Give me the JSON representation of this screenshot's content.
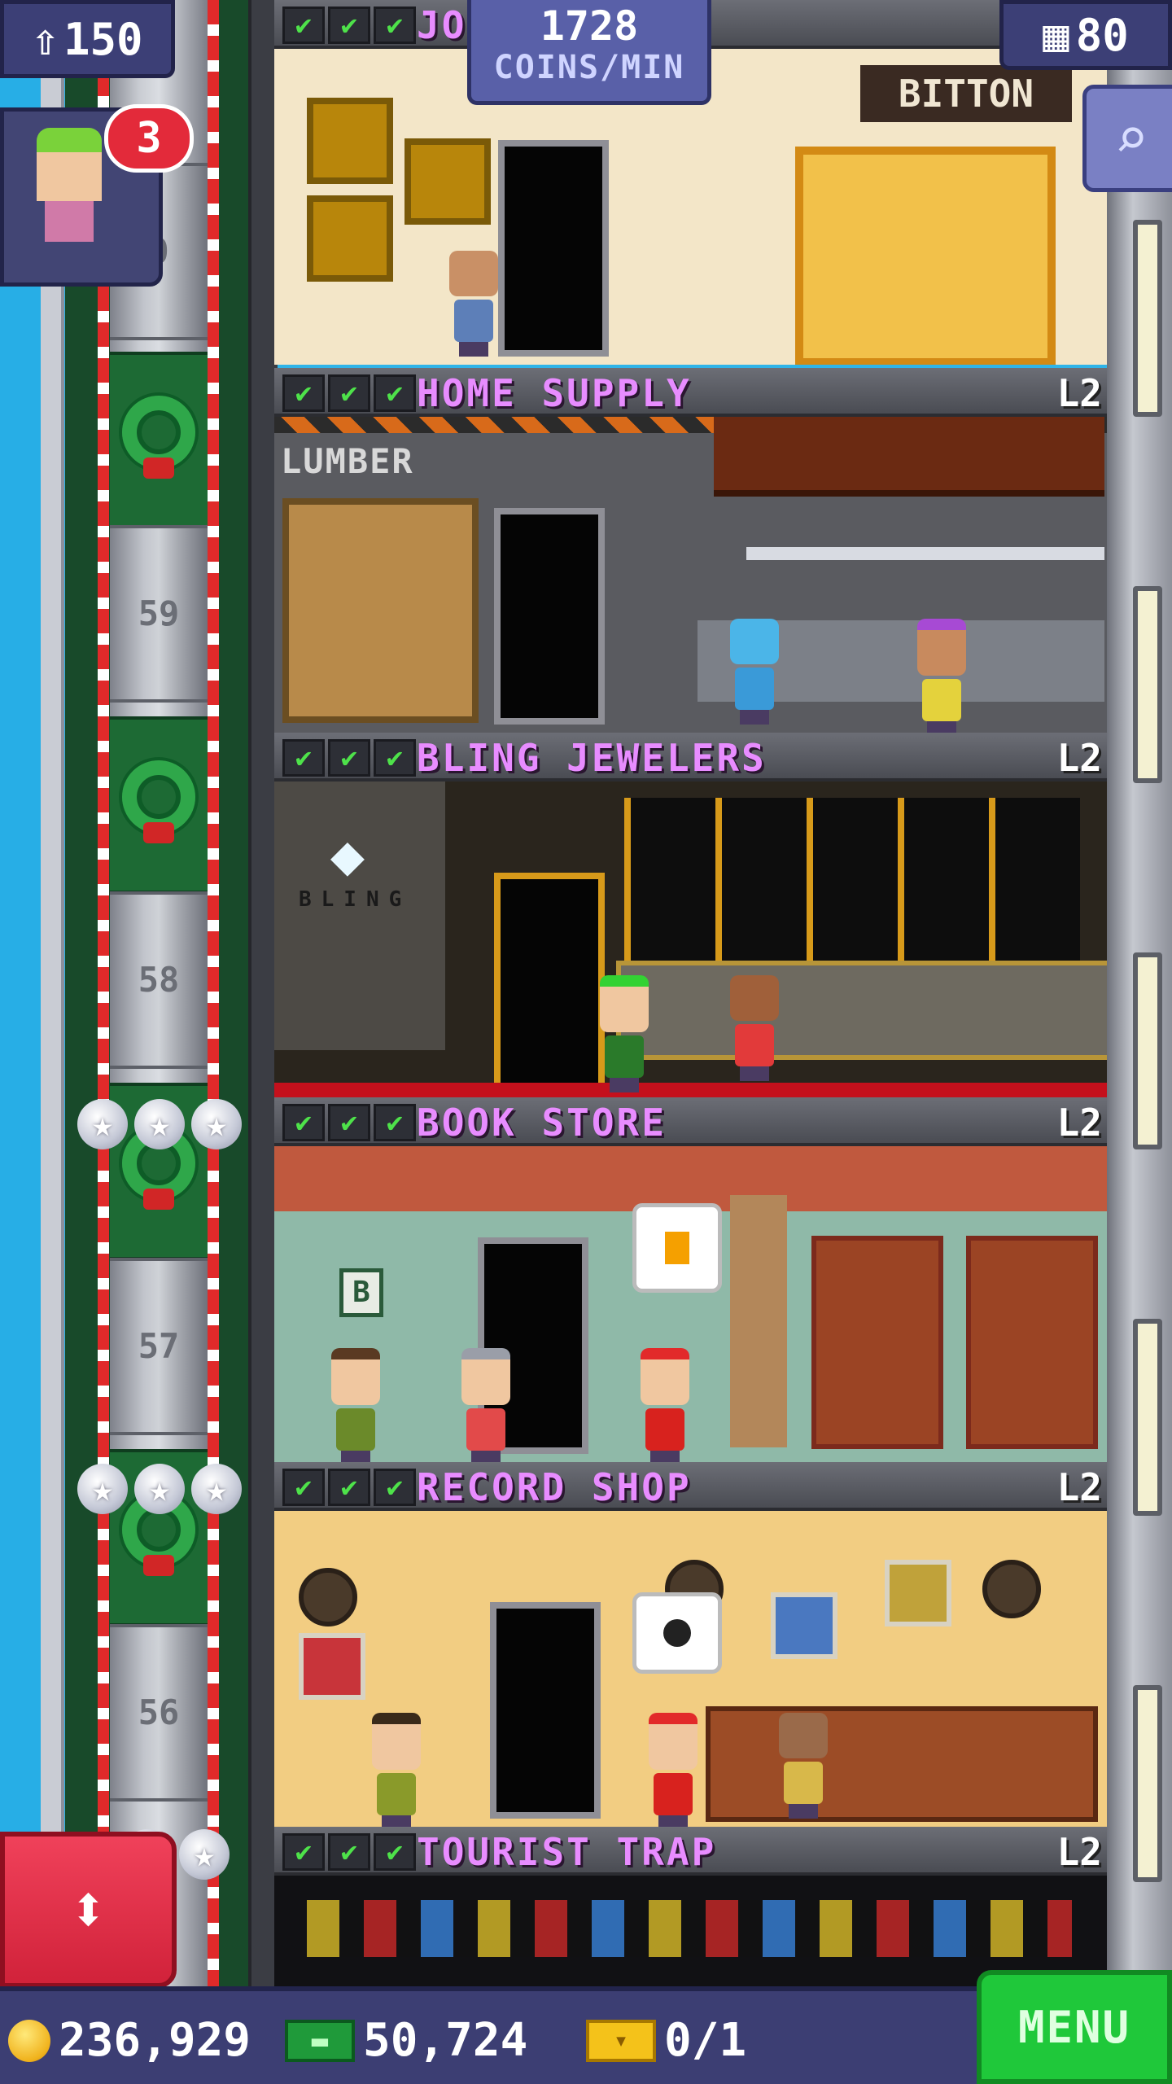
{
  "hud": {
    "population": "150",
    "population_icon": "people-icon",
    "floor_count": "80",
    "floor_icon": "building-icon",
    "coins_per_min_value": "1728",
    "coins_per_min_label": "COINS/MIN",
    "search_icon": "magnifier-icon",
    "visitor_badge": "3"
  },
  "elevator": {
    "floor_numbers": [
      "0",
      "59",
      "58",
      "57",
      "56"
    ]
  },
  "floors": [
    {
      "name": "JOIN BITTON",
      "level": "",
      "sign": "BITTON",
      "stocked": 3
    },
    {
      "name": "HOME SUPPLY",
      "level": "L2",
      "sign": "LUMBER",
      "stocked": 3
    },
    {
      "name": "BLING JEWELERS",
      "level": "L2",
      "sign": "BLING",
      "stocked": 3
    },
    {
      "name": "BOOK STORE",
      "level": "L2",
      "sign": "B",
      "stocked": 3
    },
    {
      "name": "RECORD SHOP",
      "level": "L2",
      "sign": "",
      "stocked": 3
    },
    {
      "name": "TOURIST TRAP",
      "level": "L2",
      "sign": "",
      "stocked": 3
    }
  ],
  "bottom_bar": {
    "coins": "236,929",
    "bux": "50,724",
    "tickets": "0/1",
    "menu_label": "MENU"
  },
  "colors": {
    "floor_name": "#e88cff",
    "hud_bg": "#3c3f76",
    "menu_green": "#1fc83a",
    "elevator_red": "#e02a2a"
  }
}
